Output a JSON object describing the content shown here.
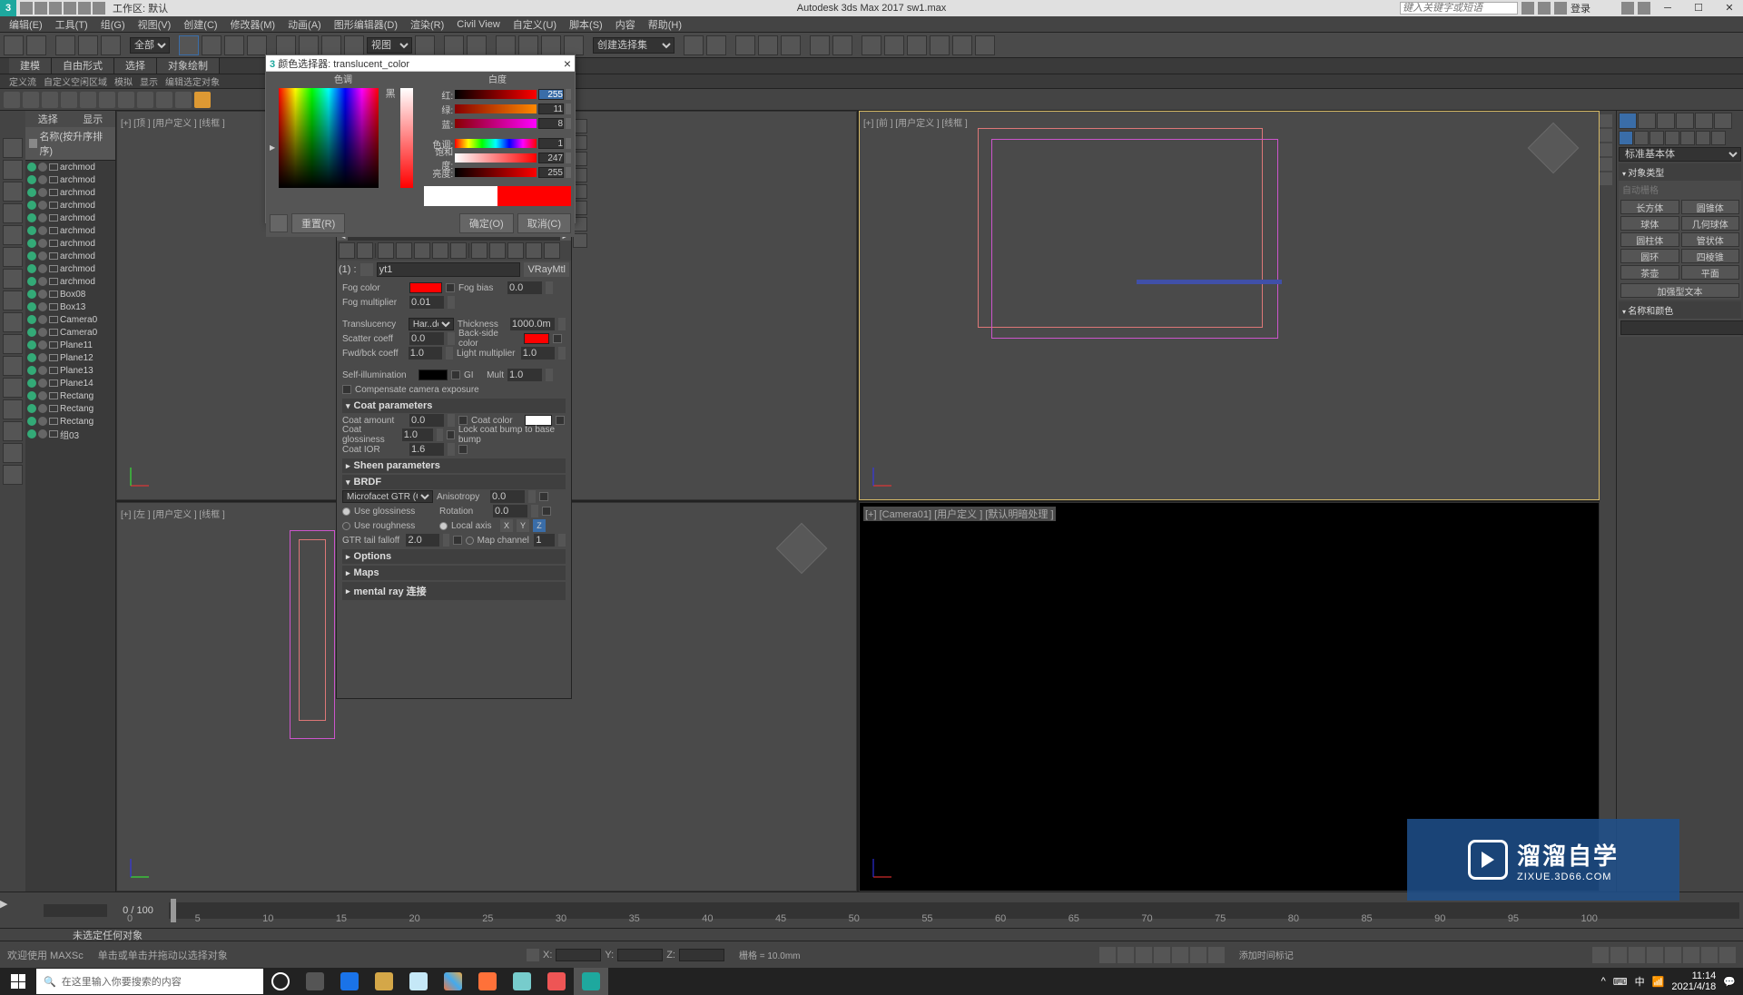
{
  "app": {
    "title": "Autodesk 3ds Max 2017   sw1.max",
    "workspace_label": "工作区: 默认",
    "search_placeholder": "键入关键字或短语",
    "login_text": "登录"
  },
  "menu": [
    "编辑(E)",
    "工具(T)",
    "组(G)",
    "视图(V)",
    "创建(C)",
    "修改器(M)",
    "动画(A)",
    "图形编辑器(D)",
    "渲染(R)",
    "Civil View",
    "自定义(U)",
    "脚本(S)",
    "内容",
    "帮助(H)"
  ],
  "main_toolbar": {
    "filter_label": "全部",
    "selection_set": "创建选择集"
  },
  "ribbon_tabs": [
    "建模",
    "自由形式",
    "选择",
    "对象绘制"
  ],
  "sub_row": [
    "定义流",
    "自定义空闲区域",
    "模拟",
    "显示",
    "编辑选定对象"
  ],
  "scene_explorer": {
    "tabs": [
      "选择",
      "显示"
    ],
    "sort_header": "名称(按升序排序)",
    "items": [
      "archmod",
      "archmod",
      "archmod",
      "archmod",
      "archmod",
      "archmod",
      "archmod",
      "archmod",
      "archmod",
      "archmod",
      "Box08",
      "Box13",
      "Camera0",
      "Camera0",
      "Plane11",
      "Plane12",
      "Plane13",
      "Plane14",
      "Rectang",
      "Rectang",
      "Rectang",
      "组03"
    ]
  },
  "viewports": {
    "top_left": "[+] [顶 ] [用户定义 ] [线框 ]",
    "top_right": "[+] [前 ] [用户定义 ] [线框 ]",
    "bottom_left": "[+] [左 ] [用户定义 ] [线框 ]",
    "bottom_right": "[+] [Camera01] [用户定义 ] [默认明暗处理 ]"
  },
  "color_picker": {
    "title": "颜色选择器: translucent_color",
    "hue_label": "色调",
    "whiteness_label": "白度",
    "rgb": {
      "r_label": "红:",
      "g_label": "绿:",
      "b_label": "蓝:",
      "r": "255",
      "g": "11",
      "b": "8"
    },
    "hsv": {
      "h_label": "色调:",
      "s_label": "饱和度:",
      "v_label": "亮度:",
      "h": "1",
      "s": "247",
      "v": "255"
    },
    "black_label": "黑",
    "reset_btn": "重置(R)",
    "ok_btn": "确定(O)",
    "cancel_btn": "取消(C)"
  },
  "material_editor": {
    "index_label": "(1) :",
    "mat_name": "yt1",
    "mat_type": "VRayMtl",
    "fog_color_label": "Fog color",
    "fog_bias_label": "Fog bias",
    "fog_bias_val": "0.0",
    "fog_mult_label": "Fog multiplier",
    "fog_mult_val": "0.01",
    "translucency_label": "Translucency",
    "translucency_type": "Har..del",
    "thickness_label": "Thickness",
    "thickness_val": "1000.0m",
    "scatter_label": "Scatter coeff",
    "scatter_val": "0.0",
    "backside_label": "Back-side color",
    "fwdbck_label": "Fwd/bck coeff",
    "fwdbck_val": "1.0",
    "lightmult_label": "Light multiplier",
    "lightmult_val": "1.0",
    "selfillum_label": "Self-illumination",
    "gi_label": "GI",
    "mult_label": "Mult",
    "mult_val": "1.0",
    "compensate_label": "Compensate camera exposure",
    "coat_hdr": "Coat parameters",
    "coat_amount_label": "Coat amount",
    "coat_amount_val": "0.0",
    "coat_color_label": "Coat color",
    "coat_gloss_label": "Coat glossiness",
    "coat_gloss_val": "1.0",
    "lock_coat_label": "Lock coat bump to base bump",
    "coat_ior_label": "Coat IOR",
    "coat_ior_val": "1.6",
    "sheen_hdr": "Sheen parameters",
    "brdf_hdr": "BRDF",
    "brdf_type": "Microfacet GTR (GGX)",
    "use_gloss": "Use glossiness",
    "use_rough": "Use roughness",
    "gtr_label": "GTR tail falloff",
    "gtr_val": "2.0",
    "aniso_label": "Anisotropy",
    "aniso_val": "0.0",
    "rotation_label": "Rotation",
    "rotation_val": "0.0",
    "localaxis_label": "Local axis",
    "axis_x": "X",
    "axis_y": "Y",
    "axis_z": "Z",
    "mapchan_label": "Map channel",
    "mapchan_val": "1",
    "options_hdr": "Options",
    "maps_hdr": "Maps",
    "mental_hdr": "mental ray 连接"
  },
  "cmd_panel": {
    "dropdown": "标准基本体",
    "obj_type_hdr": "对象类型",
    "auto_grid": "自动栅格",
    "buttons": [
      "长方体",
      "圆锥体",
      "球体",
      "几何球体",
      "圆柱体",
      "管状体",
      "圆环",
      "四棱锥",
      "茶壶",
      "平面"
    ],
    "wide_btn": "加强型文本",
    "name_color_hdr": "名称和颜色"
  },
  "timeline": {
    "frame_text": "0 / 100",
    "marks": [
      "0",
      "5",
      "10",
      "15",
      "20",
      "25",
      "30",
      "35",
      "40",
      "45",
      "50",
      "55",
      "60",
      "65",
      "70",
      "75",
      "80",
      "85",
      "90",
      "95",
      "100"
    ]
  },
  "status": {
    "sel_none": "未选定任何对象",
    "welcome": "欢迎使用 MAXSc",
    "hint": "单击或单击并拖动以选择对象",
    "x_label": "X:",
    "y_label": "Y:",
    "z_label": "Z:",
    "grid": "栅格 = 10.0mm",
    "addtime": "添加时间标记"
  },
  "taskbar": {
    "search_placeholder": "在这里输入你要搜索的内容",
    "time": "11:14",
    "date": "2021/4/18"
  },
  "watermark": {
    "big": "溜溜自学",
    "url": "ZIXUE.3D66.COM"
  }
}
